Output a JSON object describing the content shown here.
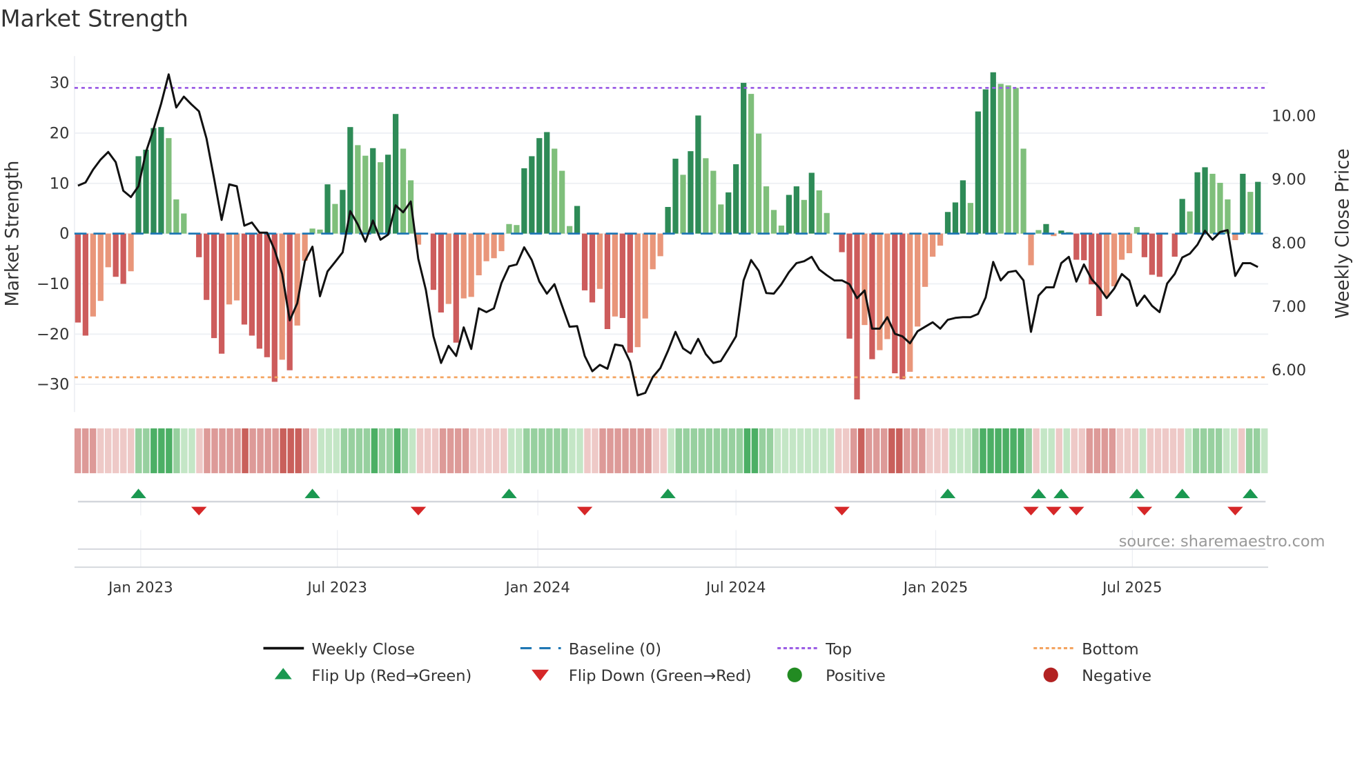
{
  "chart_data": {
    "type": "bar",
    "title": "Market Strength",
    "ylabel": "Market Strength",
    "ylabel_right": "Weekly Close Price",
    "ylim": [
      -35,
      35
    ],
    "ylim_right": [
      5.4,
      10.8
    ],
    "yticks": [
      30,
      20,
      10,
      0,
      -10,
      -20,
      -30
    ],
    "yticks_labels": [
      "30",
      "20",
      "10",
      "0",
      "−10",
      "−20",
      "−30"
    ],
    "yticks_right": [
      10,
      9,
      8,
      7,
      6
    ],
    "yticks_right_labels": [
      "10.00",
      "9.00",
      "8.00",
      "7.00",
      "6.00"
    ],
    "xticks": [
      {
        "week": 8.3,
        "label": "Jan 2023"
      },
      {
        "week": 34.3,
        "label": "Jul 2023"
      },
      {
        "week": 60.8,
        "label": "Jan 2024"
      },
      {
        "week": 87,
        "label": "Jul 2024"
      },
      {
        "week": 113.4,
        "label": "Jan 2025"
      },
      {
        "week": 139.4,
        "label": "Jul 2025"
      }
    ],
    "top_level": 29,
    "bottom_level": -28.6,
    "baseline": 0,
    "strength": [
      -17.7,
      -20.3,
      -16.5,
      -13.4,
      -6.7,
      -8.6,
      -10,
      -7.5,
      15.4,
      16.7,
      21,
      21.2,
      19,
      6.8,
      4,
      0,
      -4.7,
      -13.2,
      -20.8,
      -23.9,
      -14.1,
      -13.3,
      -18.1,
      -20.3,
      -22.9,
      -24.6,
      -29.5,
      -25.1,
      -27.2,
      -18.3,
      -5.4,
      1,
      0.8,
      9.8,
      5.9,
      8.7,
      21.2,
      17.6,
      15.5,
      17,
      14.2,
      15.7,
      23.8,
      16.9,
      10.6,
      -2.2,
      0,
      -11.2,
      -15.7,
      -14,
      -21.7,
      -12.9,
      -12.6,
      -8.3,
      -5.5,
      -4.9,
      -3.5,
      1.9,
      1.7,
      13,
      15.4,
      19,
      20.2,
      16.9,
      12.5,
      1.5,
      5.5,
      -11.3,
      -13.7,
      -11,
      -19,
      -16.5,
      -16.8,
      -23.7,
      -22.6,
      -16.9,
      -7.1,
      -4.5,
      5.3,
      14.9,
      11.7,
      16.4,
      23.5,
      15,
      12.5,
      5.8,
      8.2,
      13.8,
      30,
      27.8,
      19.9,
      9.4,
      4.7,
      1.6,
      7.7,
      9.4,
      6.7,
      12.1,
      8.6,
      4.1,
      0,
      -3.7,
      -20.9,
      -33,
      -18.2,
      -25,
      -23.2,
      -21,
      -27.8,
      -29,
      -27.5,
      -18.5,
      -10.6,
      -4.6,
      -2.4,
      4.3,
      6.2,
      10.6,
      6.1,
      24.3,
      28.7,
      32.1,
      29.8,
      29.5,
      29,
      16.9,
      -6.3,
      0.7,
      1.9,
      -0.5,
      0.6,
      0.3,
      -5.2,
      -5.3,
      -10.1,
      -16.4,
      -12.5,
      -10.5,
      -5.2,
      -3.9,
      1.3,
      -4.7,
      -8.2,
      -8.6,
      0,
      -4.6,
      6.9,
      4.4,
      12.2,
      13.2,
      11.9,
      10.1,
      6.8,
      -1.3,
      11.9,
      8.3,
      10.3
    ],
    "weekly_close": [
      8.89,
      8.94,
      9.14,
      9.3,
      9.42,
      9.26,
      8.81,
      8.71,
      8.88,
      9.42,
      9.78,
      10.18,
      10.64,
      10.12,
      10.29,
      10.17,
      10.06,
      9.63,
      9.0,
      8.35,
      8.91,
      8.88,
      8.26,
      8.31,
      8.15,
      8.15,
      7.88,
      7.5,
      6.77,
      7.04,
      7.7,
      7.93,
      7.15,
      7.54,
      7.69,
      7.84,
      8.49,
      8.28,
      8.01,
      8.34,
      8.04,
      8.12,
      8.58,
      8.47,
      8.64,
      7.74,
      7.25,
      6.52,
      6.1,
      6.37,
      6.21,
      6.66,
      6.32,
      6.96,
      6.9,
      6.96,
      7.36,
      7.62,
      7.65,
      7.92,
      7.72,
      7.38,
      7.19,
      7.34,
      7.0,
      6.67,
      6.68,
      6.21,
      5.97,
      6.07,
      6.01,
      6.39,
      6.37,
      6.12,
      5.59,
      5.63,
      5.88,
      6.02,
      6.29,
      6.59,
      6.33,
      6.25,
      6.48,
      6.24,
      6.1,
      6.13,
      6.32,
      6.52,
      7.4,
      7.72,
      7.55,
      7.2,
      7.19,
      7.34,
      7.53,
      7.67,
      7.7,
      7.77,
      7.57,
      7.48,
      7.4,
      7.4,
      7.34,
      7.12,
      7.24,
      6.64,
      6.64,
      6.82,
      6.56,
      6.52,
      6.41,
      6.6,
      6.67,
      6.74,
      6.64,
      6.78,
      6.81,
      6.82,
      6.82,
      6.87,
      7.13,
      7.69,
      7.4,
      7.53,
      7.55,
      7.4,
      6.59,
      7.16,
      7.29,
      7.29,
      7.67,
      7.77,
      7.38,
      7.65,
      7.42,
      7.29,
      7.12,
      7.27,
      7.5,
      7.4,
      7.0,
      7.16,
      7.0,
      6.9,
      7.35,
      7.5,
      7.76,
      7.82,
      7.96,
      8.18,
      8.04,
      8.16,
      8.19,
      7.47,
      7.67,
      7.67,
      7.61
    ],
    "regime_strip": [
      -2,
      -2,
      -2,
      -1,
      -1,
      -1,
      -1,
      -1,
      2,
      2,
      3,
      3,
      3,
      2,
      1,
      1,
      -1,
      -2,
      -2,
      -2,
      -2,
      -2,
      -3,
      -2,
      -2,
      -2,
      -2,
      -3,
      -3,
      -3,
      -2,
      -1,
      1,
      1,
      1,
      2,
      2,
      2,
      2,
      3,
      2,
      2,
      3,
      2,
      1,
      -1,
      -1,
      -1,
      -2,
      -2,
      -2,
      -2,
      -1,
      -1,
      -1,
      -1,
      -1,
      1,
      1,
      2,
      2,
      2,
      2,
      2,
      2,
      1,
      1,
      -1,
      -1,
      -2,
      -2,
      -2,
      -2,
      -2,
      -2,
      -2,
      -1,
      -1,
      1,
      2,
      2,
      2,
      2,
      2,
      2,
      2,
      2,
      2,
      3,
      3,
      2,
      2,
      1,
      1,
      1,
      1,
      1,
      1,
      1,
      1,
      -1,
      -1,
      -2,
      -3,
      -2,
      -2,
      -2,
      -3,
      -3,
      -2,
      -2,
      -2,
      -1,
      -1,
      -1,
      1,
      1,
      1,
      2,
      3,
      3,
      3,
      3,
      3,
      3,
      2,
      -1,
      1,
      1,
      -1,
      1,
      -1,
      -1,
      -2,
      -2,
      -2,
      -2,
      -1,
      -1,
      -1,
      1,
      -1,
      -1,
      -1,
      -1,
      -1,
      1,
      2,
      2,
      2,
      2,
      1,
      1,
      -1,
      2,
      2,
      1
    ],
    "flip_up_weeks": [
      8,
      31,
      57,
      78,
      115,
      127,
      130,
      140,
      146,
      155
    ],
    "flip_down_weeks": [
      16,
      45,
      67,
      101,
      126,
      129,
      132,
      141,
      153
    ],
    "legend": [
      {
        "label": "Weekly Close",
        "symbol": "line",
        "color": "#111111"
      },
      {
        "label": "Baseline (0)",
        "symbol": "dash",
        "color": "#1f77b4"
      },
      {
        "label": "Top",
        "symbol": "dot",
        "color": "#9b5de5"
      },
      {
        "label": "Bottom",
        "symbol": "dot",
        "color": "#f4a460"
      },
      {
        "label": "Flip Up (Red→Green)",
        "symbol": "triangle-up",
        "color": "#1a9850"
      },
      {
        "label": "Flip Down (Green→Red)",
        "symbol": "triangle-down",
        "color": "#d62728"
      },
      {
        "label": "Positive",
        "symbol": "circle",
        "color": "#228b22"
      },
      {
        "label": "Negative",
        "symbol": "circle",
        "color": "#b22222"
      }
    ],
    "legend_placement": "bottom",
    "source": "source: sharemaestro.com",
    "colors": {
      "pos_strong": "#2e8b57",
      "pos_weak": "#7fbf7b",
      "neg_strong": "#cd5c5c",
      "neg_weak": "#e9967a",
      "top": "#9b5de5",
      "bottom": "#f4a460",
      "baseline": "#1f77b4",
      "flip_up": "#1a9850",
      "flip_down": "#d62728"
    }
  }
}
